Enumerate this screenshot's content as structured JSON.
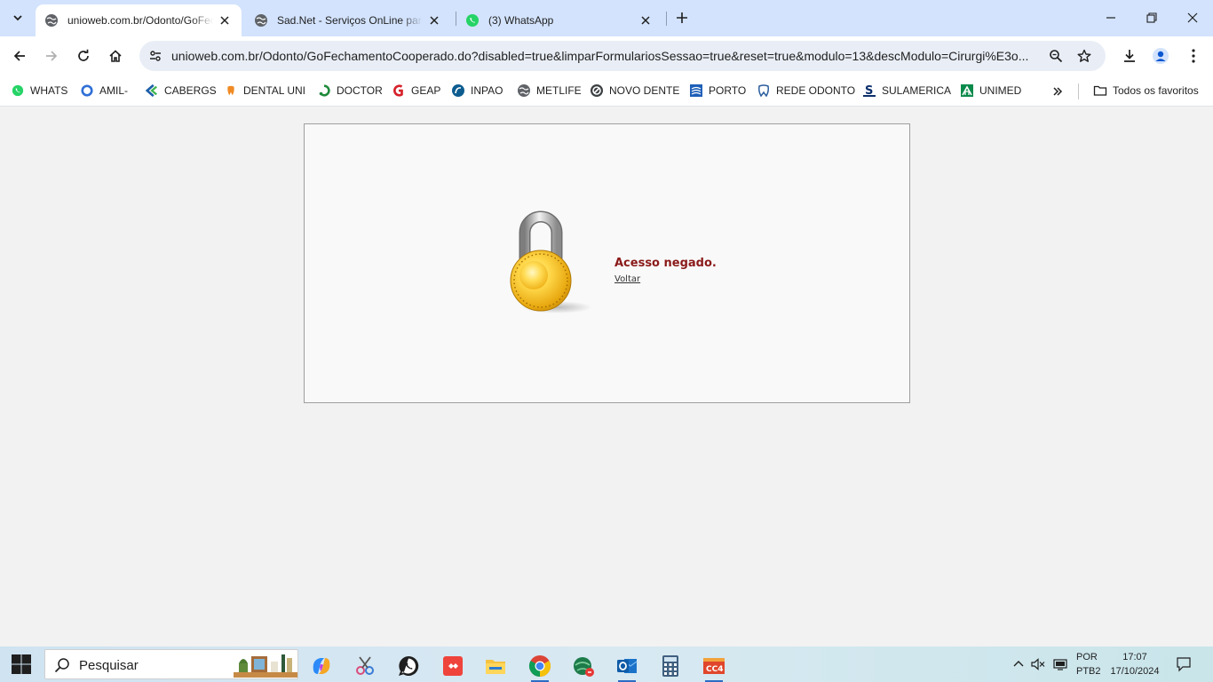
{
  "browser": {
    "tabs": [
      {
        "title": "unioweb.com.br/Odonto/GoFec",
        "icon": "globe-icon",
        "active": true
      },
      {
        "title": "Sad.Net - Serviços OnLine para",
        "icon": "globe-icon",
        "active": false
      },
      {
        "title": "(3) WhatsApp",
        "icon": "whatsapp-icon",
        "active": false
      }
    ],
    "url": "unioweb.com.br/Odonto/GoFechamentoCooperado.do?disabled=true&limparFormulariosSessao=true&reset=true&modulo=13&descModulo=Cirurgi%E3o...",
    "bookmarks": [
      {
        "label": "WHATS",
        "icon": "whatsapp-icon"
      },
      {
        "label": "AMIL-",
        "icon": "amil-icon"
      },
      {
        "label": "CABERGS",
        "icon": "cabergs-icon"
      },
      {
        "label": "DENTAL UNI",
        "icon": "dental-uni-icon"
      },
      {
        "label": "DOCTOR",
        "icon": "doctor-icon"
      },
      {
        "label": "GEAP",
        "icon": "geap-icon"
      },
      {
        "label": "INPAO",
        "icon": "inpao-icon"
      },
      {
        "label": "METLIFE",
        "icon": "globe-icon"
      },
      {
        "label": "NOVO DENTE",
        "icon": "novo-dente-icon"
      },
      {
        "label": "PORTO",
        "icon": "porto-icon"
      },
      {
        "label": "REDE ODONTO",
        "icon": "tooth-icon"
      },
      {
        "label": "SULAMERICA",
        "icon": "sulamerica-icon"
      },
      {
        "label": "UNIMED",
        "icon": "unimed-icon"
      }
    ],
    "all_bookmarks": "Todos os favoritos"
  },
  "page": {
    "message": "Acesso negado.",
    "back_link": "Voltar"
  },
  "taskbar": {
    "search_placeholder": "Pesquisar",
    "apps": [
      "copilot-icon",
      "snipping-tool-icon",
      "whatsapp-icon",
      "anydesk-icon",
      "file-explorer-icon",
      "chrome-icon",
      "web-app-icon",
      "outlook-icon",
      "calculator-icon",
      "cc4-icon"
    ],
    "lang_line1": "POR",
    "lang_line2": "PTB2",
    "time": "17:07",
    "date": "17/10/2024"
  },
  "colors": {
    "tabstrip": "#d3e3fd",
    "denied_text": "#8b1a1a",
    "accent": "#0b57d0"
  }
}
